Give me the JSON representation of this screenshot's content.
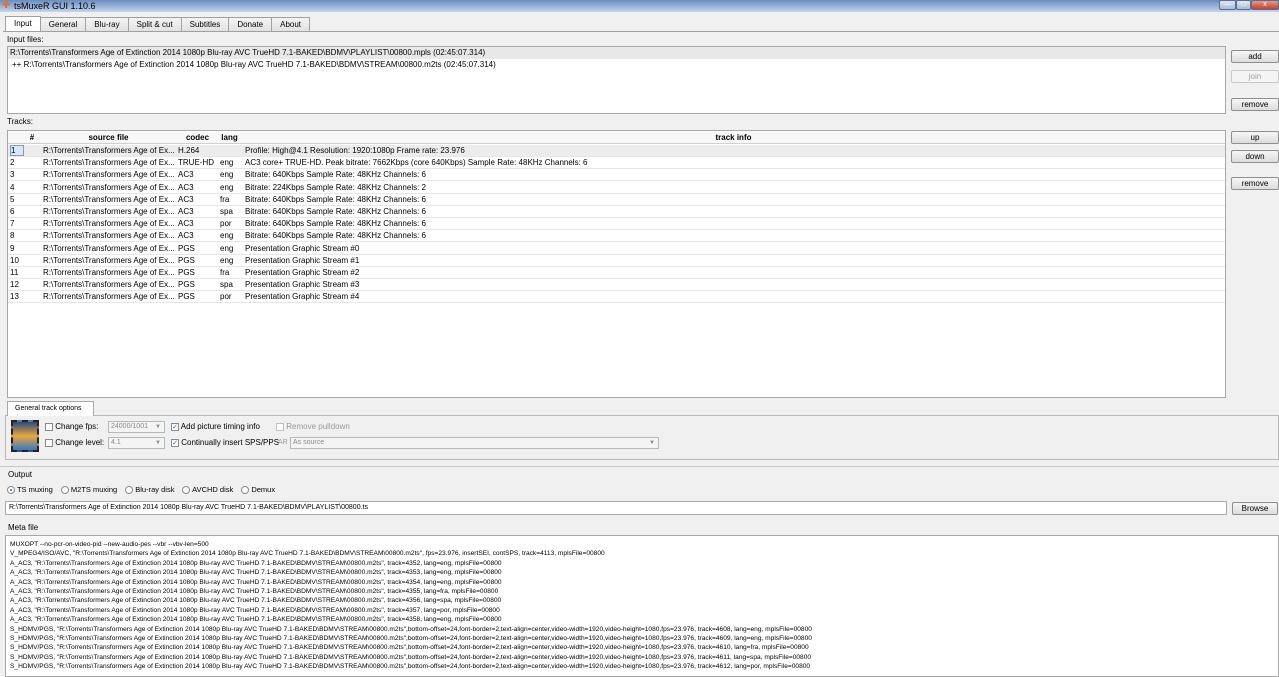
{
  "window": {
    "title": "tsMuxeR GUI 1.10.6",
    "minimize": "—",
    "maximize": "□",
    "close": "x"
  },
  "tabs": [
    "Input",
    "General",
    "Blu-ray",
    "Split & cut",
    "Subtitles",
    "Donate",
    "About"
  ],
  "input": {
    "label": "Input files:",
    "files": [
      "R:\\Torrents\\Transformers Age of Extinction 2014 1080p Blu-ray AVC TrueHD 7.1-BAKED\\BDMV\\PLAYLIST\\00800.mpls (02:45:07.314)",
      "++ R:\\Torrents\\Transformers Age of Extinction 2014 1080p Blu-ray AVC TrueHD 7.1-BAKED\\BDMV\\STREAM\\00800.m2ts (02:45:07.314)"
    ],
    "add": "add",
    "join": "join",
    "remove": "remove"
  },
  "tracks": {
    "label": "Tracks:",
    "headers": {
      "num": "#",
      "source": "source file",
      "codec": "codec",
      "lang": "lang",
      "info": "track info"
    },
    "up": "up",
    "down": "down",
    "remove": "remove",
    "rows": [
      {
        "n": "1",
        "src": "R:\\Torrents\\Transformers Age of Ex...",
        "codec": "H.264",
        "lang": "",
        "info": "Profile: High@4.1  Resolution: 1920:1080p  Frame rate: 23.976",
        "checked": true
      },
      {
        "n": "2",
        "src": "R:\\Torrents\\Transformers Age of Ex...",
        "codec": "TRUE-HD",
        "lang": "eng",
        "info": "AC3 core+ TRUE-HD. Peak bitrate: 7662Kbps (core 640Kbps) Sample Rate: 48KHz Channels: 6",
        "checked": true
      },
      {
        "n": "3",
        "src": "R:\\Torrents\\Transformers Age of Ex...",
        "codec": "AC3",
        "lang": "eng",
        "info": "Bitrate: 640Kbps Sample Rate: 48KHz Channels: 6",
        "checked": true
      },
      {
        "n": "4",
        "src": "R:\\Torrents\\Transformers Age of Ex...",
        "codec": "AC3",
        "lang": "eng",
        "info": "Bitrate: 224Kbps Sample Rate: 48KHz Channels: 2",
        "checked": true
      },
      {
        "n": "5",
        "src": "R:\\Torrents\\Transformers Age of Ex...",
        "codec": "AC3",
        "lang": "fra",
        "info": "Bitrate: 640Kbps Sample Rate: 48KHz Channels: 6",
        "checked": true
      },
      {
        "n": "6",
        "src": "R:\\Torrents\\Transformers Age of Ex...",
        "codec": "AC3",
        "lang": "spa",
        "info": "Bitrate: 640Kbps Sample Rate: 48KHz Channels: 6",
        "checked": true
      },
      {
        "n": "7",
        "src": "R:\\Torrents\\Transformers Age of Ex...",
        "codec": "AC3",
        "lang": "por",
        "info": "Bitrate: 640Kbps Sample Rate: 48KHz Channels: 6",
        "checked": true
      },
      {
        "n": "8",
        "src": "R:\\Torrents\\Transformers Age of Ex...",
        "codec": "AC3",
        "lang": "eng",
        "info": "Bitrate: 640Kbps Sample Rate: 48KHz Channels: 6",
        "checked": true
      },
      {
        "n": "9",
        "src": "R:\\Torrents\\Transformers Age of Ex...",
        "codec": "PGS",
        "lang": "eng",
        "info": "Presentation Graphic Stream #0",
        "checked": true
      },
      {
        "n": "10",
        "src": "R:\\Torrents\\Transformers Age of Ex...",
        "codec": "PGS",
        "lang": "eng",
        "info": "Presentation Graphic Stream #1",
        "checked": true
      },
      {
        "n": "11",
        "src": "R:\\Torrents\\Transformers Age of Ex...",
        "codec": "PGS",
        "lang": "fra",
        "info": "Presentation Graphic Stream #2",
        "checked": true
      },
      {
        "n": "12",
        "src": "R:\\Torrents\\Transformers Age of Ex...",
        "codec": "PGS",
        "lang": "spa",
        "info": "Presentation Graphic Stream #3",
        "checked": true
      },
      {
        "n": "13",
        "src": "R:\\Torrents\\Transformers Age of Ex...",
        "codec": "PGS",
        "lang": "por",
        "info": "Presentation Graphic Stream #4",
        "checked": true
      }
    ]
  },
  "options": {
    "tab": "General track options",
    "change_fps": "Change fps:",
    "fps_value": "24000/1001",
    "change_level": "Change level:",
    "level_value": "4.1",
    "add_timing": "Add picture timing info",
    "insert_sps": "Continually insert SPS/PPS",
    "remove_pulldown": "Remove pulldown",
    "ar_label": "AR",
    "ar_value": "As source"
  },
  "output": {
    "label": "Output",
    "modes": [
      "TS muxing",
      "M2TS muxing",
      "Blu-ray disk",
      "AVCHD disk",
      "Demux"
    ],
    "selected": 0,
    "path": "R:\\Torrents\\Transformers Age of Extinction 2014 1080p Blu-ray AVC TrueHD 7.1-BAKED\\BDMV\\PLAYLIST\\00800.ts",
    "browse": "Browse"
  },
  "meta": {
    "label": "Meta file",
    "lines": [
      "MUXOPT --no-pcr-on-video-pid --new-audio-pes --vbr  --vbv-len=500",
      "V_MPEG4/ISO/AVC, \"R:\\Torrents\\Transformers Age of Extinction 2014 1080p Blu-ray AVC TrueHD 7.1-BAKED\\BDMV\\STREAM\\00800.m2ts\", fps=23.976, insertSEI, contSPS, track=4113, mplsFile=00800",
      "A_AC3, \"R:\\Torrents\\Transformers Age of Extinction 2014 1080p Blu-ray AVC TrueHD 7.1-BAKED\\BDMV\\STREAM\\00800.m2ts\", track=4352, lang=eng, mplsFile=00800",
      "A_AC3, \"R:\\Torrents\\Transformers Age of Extinction 2014 1080p Blu-ray AVC TrueHD 7.1-BAKED\\BDMV\\STREAM\\00800.m2ts\", track=4353, lang=eng, mplsFile=00800",
      "A_AC3, \"R:\\Torrents\\Transformers Age of Extinction 2014 1080p Blu-ray AVC TrueHD 7.1-BAKED\\BDMV\\STREAM\\00800.m2ts\", track=4354, lang=eng, mplsFile=00800",
      "A_AC3, \"R:\\Torrents\\Transformers Age of Extinction 2014 1080p Blu-ray AVC TrueHD 7.1-BAKED\\BDMV\\STREAM\\00800.m2ts\", track=4355, lang=fra, mplsFile=00800",
      "A_AC3, \"R:\\Torrents\\Transformers Age of Extinction 2014 1080p Blu-ray AVC TrueHD 7.1-BAKED\\BDMV\\STREAM\\00800.m2ts\", track=4356, lang=spa, mplsFile=00800",
      "A_AC3, \"R:\\Torrents\\Transformers Age of Extinction 2014 1080p Blu-ray AVC TrueHD 7.1-BAKED\\BDMV\\STREAM\\00800.m2ts\", track=4357, lang=por, mplsFile=00800",
      "A_AC3, \"R:\\Torrents\\Transformers Age of Extinction 2014 1080p Blu-ray AVC TrueHD 7.1-BAKED\\BDMV\\STREAM\\00800.m2ts\", track=4358, lang=eng, mplsFile=00800",
      "S_HDMV/PGS, \"R:\\Torrents\\Transformers Age of Extinction 2014 1080p Blu-ray AVC TrueHD 7.1-BAKED\\BDMV\\STREAM\\00800.m2ts\",bottom-offset=24,font-border=2,text-align=center,video-width=1920,video-height=1080,fps=23.976, track=4608, lang=eng, mplsFile=00800",
      "S_HDMV/PGS, \"R:\\Torrents\\Transformers Age of Extinction 2014 1080p Blu-ray AVC TrueHD 7.1-BAKED\\BDMV\\STREAM\\00800.m2ts\",bottom-offset=24,font-border=2,text-align=center,video-width=1920,video-height=1080,fps=23.976, track=4609, lang=eng, mplsFile=00800",
      "S_HDMV/PGS, \"R:\\Torrents\\Transformers Age of Extinction 2014 1080p Blu-ray AVC TrueHD 7.1-BAKED\\BDMV\\STREAM\\00800.m2ts\",bottom-offset=24,font-border=2,text-align=center,video-width=1920,video-height=1080,fps=23.976, track=4610, lang=fra, mplsFile=00800",
      "S_HDMV/PGS, \"R:\\Torrents\\Transformers Age of Extinction 2014 1080p Blu-ray AVC TrueHD 7.1-BAKED\\BDMV\\STREAM\\00800.m2ts\",bottom-offset=24,font-border=2,text-align=center,video-width=1920,video-height=1080,fps=23.976, track=4611, lang=spa, mplsFile=00800",
      "S_HDMV/PGS, \"R:\\Torrents\\Transformers Age of Extinction 2014 1080p Blu-ray AVC TrueHD 7.1-BAKED\\BDMV\\STREAM\\00800.m2ts\",bottom-offset=24,font-border=2,text-align=center,video-width=1920,video-height=1080,fps=23.976, track=4612, lang=por, mplsFile=00800"
    ]
  }
}
